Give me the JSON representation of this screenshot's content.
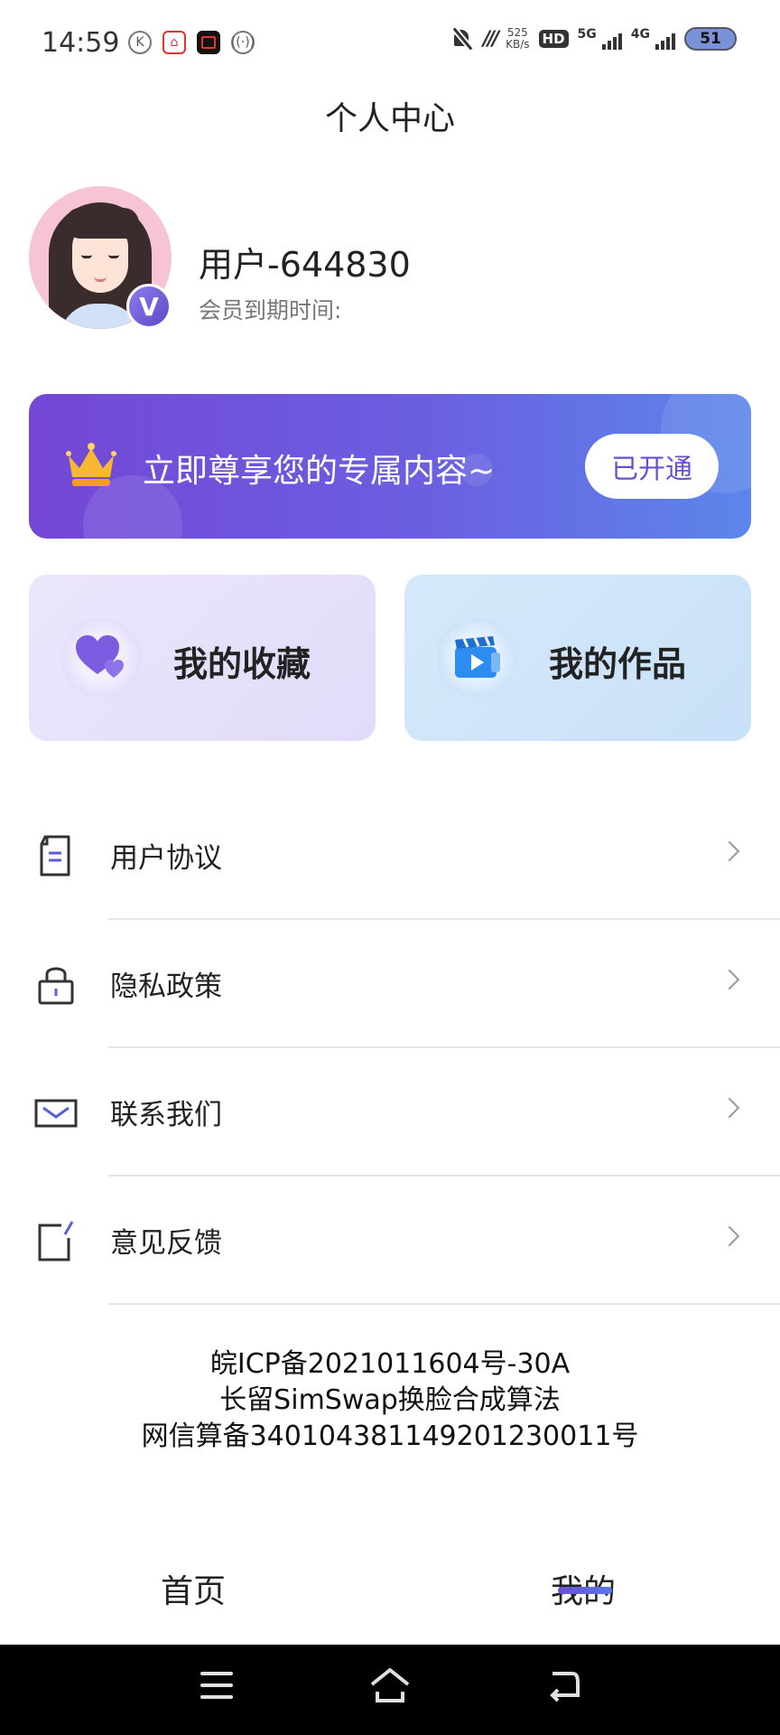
{
  "status_bar": {
    "time": "14:59",
    "net_speed_value": "525",
    "net_speed_unit": "KB/s",
    "hd_label": "HD",
    "sim1": "5G",
    "sim2": "4G",
    "battery": "51"
  },
  "header": {
    "title": "个人中心"
  },
  "profile": {
    "username": "用户-644830",
    "expiry_label": "会员到期时间:",
    "badge": "V"
  },
  "vip_banner": {
    "text": "立即尊享您的专属内容~",
    "button_label": "已开通"
  },
  "cards": [
    {
      "label": "我的收藏",
      "icon": "heart-icon"
    },
    {
      "label": "我的作品",
      "icon": "video-clapper-icon"
    }
  ],
  "menu": [
    {
      "label": "用户协议",
      "icon": "document-icon"
    },
    {
      "label": "隐私政策",
      "icon": "lock-icon"
    },
    {
      "label": "联系我们",
      "icon": "envelope-icon"
    },
    {
      "label": "意见反馈",
      "icon": "edit-icon"
    }
  ],
  "footer": {
    "icp_line1": "皖ICP备2021011604号-30A",
    "icp_line2": "长留SimSwap换脸合成算法",
    "icp_line3": "网信算备340104381149201230011号"
  },
  "tabs": [
    {
      "label": "首页",
      "active": false
    },
    {
      "label": "我的",
      "active": true
    }
  ],
  "colors": {
    "accent": "#6a4fd3",
    "banner_start": "#7447d6",
    "banner_end": "#5b86ea"
  }
}
